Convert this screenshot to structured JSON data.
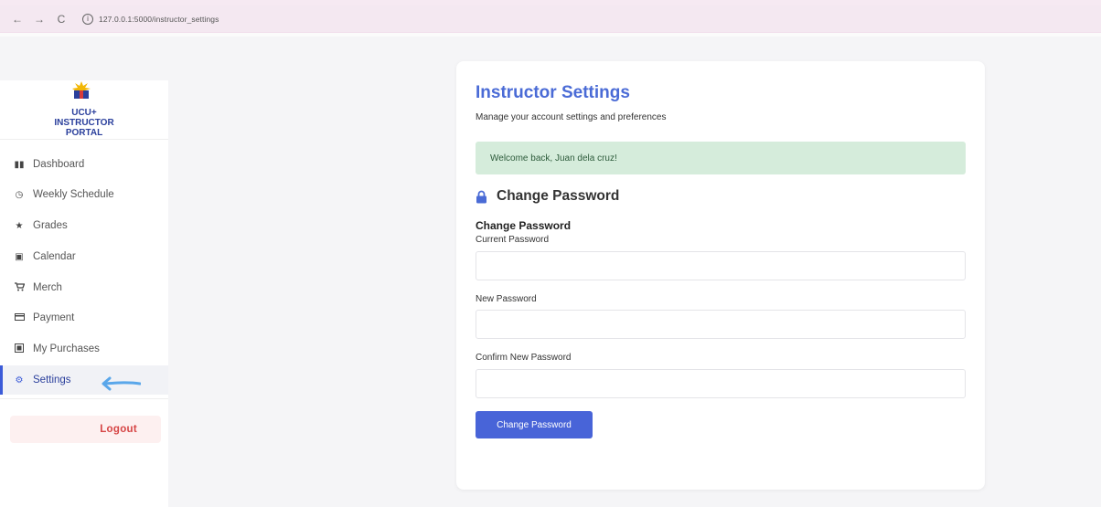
{
  "browser": {
    "back": "←",
    "forward": "→",
    "reload": "C",
    "url": "127.0.0.1:5000/instructor_settings"
  },
  "sidebar": {
    "logo_text": [
      "UCU+",
      "INSTRUCTOR",
      "PORTAL"
    ],
    "items": [
      {
        "label": "Dashboard",
        "icon": "dashboard-icon"
      },
      {
        "label": "Weekly Schedule",
        "icon": "clock-icon"
      },
      {
        "label": "Grades",
        "icon": "star-icon"
      },
      {
        "label": "Calendar",
        "icon": "calendar-icon"
      },
      {
        "label": "Merch",
        "icon": "cart-icon"
      },
      {
        "label": "Payment",
        "icon": "credit-card-icon"
      },
      {
        "label": "My Purchases",
        "icon": "receipt-icon"
      },
      {
        "label": "Settings",
        "icon": "gear-icon",
        "active": true
      }
    ],
    "logout_label": "Logout"
  },
  "main": {
    "title": "Instructor Settings",
    "subtitle": "Manage your account settings and preferences",
    "welcome": "Welcome back, Juan dela cruz!",
    "section_title": "Change Password",
    "form_heading": "Change Password",
    "fields": [
      {
        "label": "Current Password",
        "value": ""
      },
      {
        "label": "New Password",
        "value": ""
      },
      {
        "label": "Confirm New Password",
        "value": ""
      }
    ],
    "submit_label": "Change Password"
  },
  "colors": {
    "accent": "#4864d8",
    "title": "#4a6bd6",
    "success_bg": "#d5ecdb",
    "logout": "#d64545"
  }
}
